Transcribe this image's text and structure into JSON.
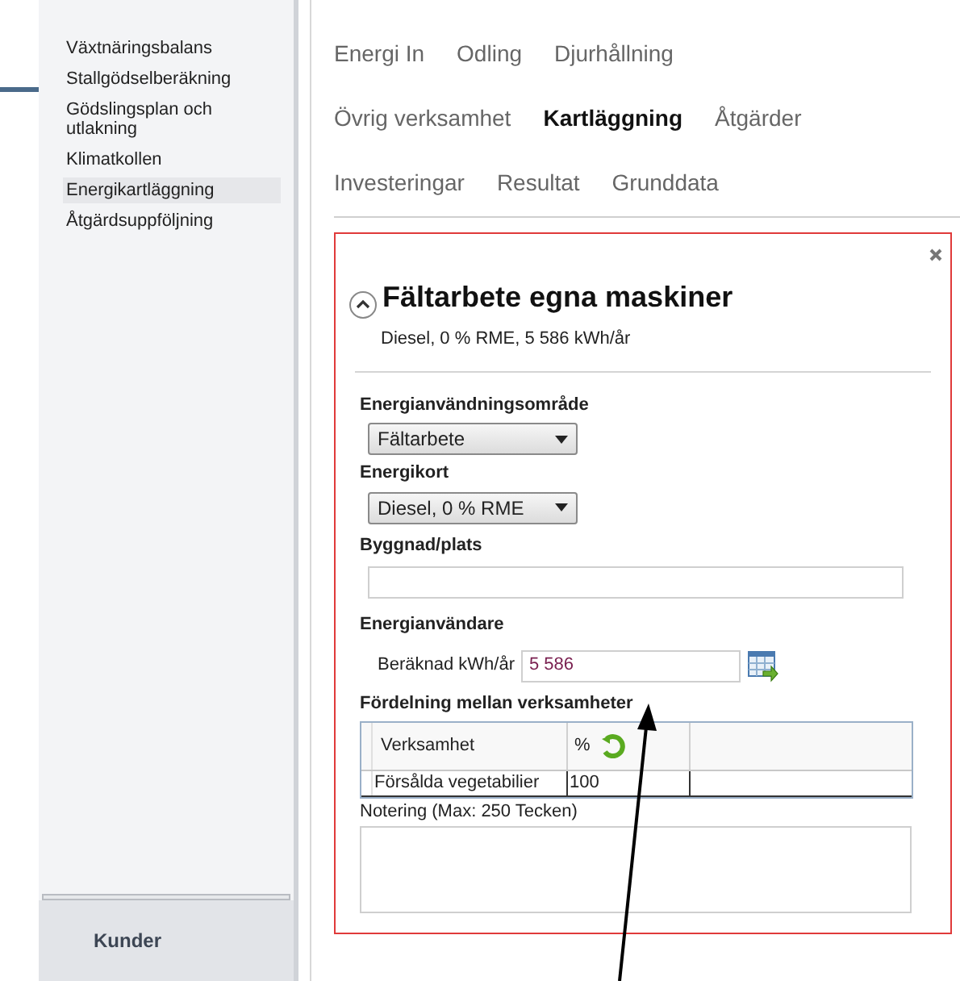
{
  "sidebar": {
    "items": [
      {
        "label": "Växtnäringsbalans",
        "selected": false
      },
      {
        "label": "Stallgödselberäkning",
        "selected": false
      },
      {
        "label": "Gödslingsplan och utlakning",
        "selected": false
      },
      {
        "label": "Klimatkollen",
        "selected": false
      },
      {
        "label": "Energikartläggning",
        "selected": true
      },
      {
        "label": "Åtgärdsuppföljning",
        "selected": false
      }
    ],
    "footer": "Kunder"
  },
  "tab_rows": [
    [
      {
        "label": "Energi In",
        "selected": false
      },
      {
        "label": "Odling",
        "selected": false
      },
      {
        "label": "Djurhållning",
        "selected": false
      }
    ],
    [
      {
        "label": "Övrig verksamhet",
        "selected": false
      },
      {
        "label": "Kartläggning",
        "selected": true
      },
      {
        "label": "Åtgärder",
        "selected": false
      }
    ],
    [
      {
        "label": "Investeringar",
        "selected": false
      },
      {
        "label": "Resultat",
        "selected": false
      },
      {
        "label": "Grunddata",
        "selected": false
      }
    ]
  ],
  "panel": {
    "title": "Fältarbete egna maskiner",
    "expanded": true,
    "subtitle": "Diesel, 0 % RME, 5 586 kWh/år",
    "usage_area": {
      "label": "Energianvändningsområde",
      "value": "Fältarbete"
    },
    "energy_card": {
      "label": "Energikort",
      "value": "Diesel, 0 % RME"
    },
    "building": {
      "label": "Byggnad/plats"
    },
    "consumer": {
      "label": "Energianvändare",
      "field_label": "Beräknad kWh/år",
      "value": "5 586"
    },
    "distribution": {
      "label": "Fördelning mellan verksamheter",
      "columns": [
        "Verksamhet",
        "%"
      ],
      "rows": [
        [
          "Försålda vegetabilier",
          "100"
        ]
      ]
    },
    "note": {
      "label": "Notering (Max: 250 Tecken)"
    }
  }
}
